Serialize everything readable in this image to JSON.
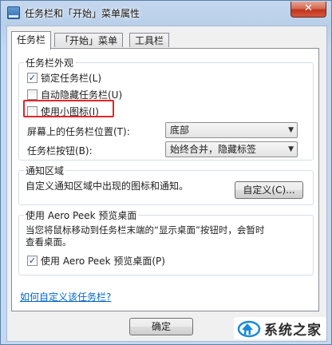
{
  "window": {
    "title": "任务栏和「开始」菜单属性",
    "close_label": "✕"
  },
  "tabs": [
    {
      "label": "任务栏",
      "active": true
    },
    {
      "label": "「开始」菜单",
      "active": false
    },
    {
      "label": "工具栏",
      "active": false
    }
  ],
  "appearance": {
    "title": "任务栏外观",
    "lock_taskbar": {
      "label": "锁定任务栏(L)",
      "checked": true
    },
    "auto_hide": {
      "label": "自动隐藏任务栏(U)",
      "checked": false
    },
    "small_icons": {
      "label": "使用小图标(I)",
      "checked": false
    },
    "location_label": "屏幕上的任务栏位置(T):",
    "location_value": "底部",
    "buttons_label": "任务栏按钮(B):",
    "buttons_value": "始终合并，隐藏标签"
  },
  "notification": {
    "title": "通知区域",
    "description": "自定义通知区域中出现的图标和通知。",
    "customize_label": "自定义(C)..."
  },
  "aero_peek": {
    "title": "使用 Aero Peek 预览桌面",
    "description_line1": "当您将鼠标移动到任务栏末端的“显示桌面”按钮时，会暂时",
    "description_line2": "查看桌面。",
    "checkbox": {
      "label": "使用 Aero Peek 预览桌面(P)",
      "checked": true
    }
  },
  "help_link": "如何自定义该任务栏?",
  "footer": {
    "ok_label": "确定"
  },
  "watermark": {
    "text": "系统之家"
  },
  "colors": {
    "highlight": "#e0262b",
    "link": "#0066cc",
    "titlebar": "#b9cfe9",
    "close": "#c1341d"
  }
}
